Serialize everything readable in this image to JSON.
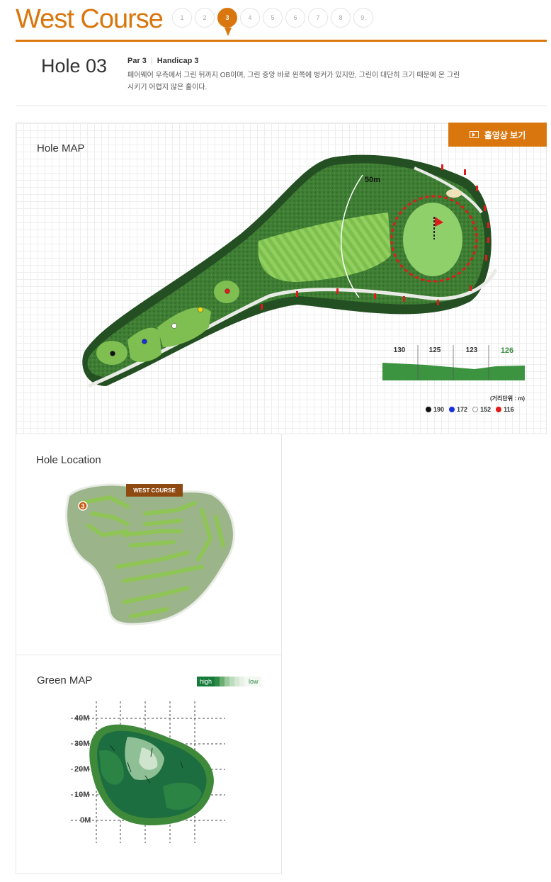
{
  "course": {
    "title": "West Course",
    "holes": [
      "1",
      "2",
      "3",
      "4",
      "5",
      "6",
      "7",
      "8",
      "9."
    ],
    "active_hole": "3"
  },
  "hole": {
    "name": "Hole 03",
    "par": "Par 3",
    "handicap": "Handicap 3",
    "description": "페어웨어 우측에서 그린 뒤까지 OB이며, 그린 중앙 바로 왼쪽에 벙커가 있지만, 그린이 대단히 크기 때문에 온 그린 시키기 어렵지 않은 홀이다."
  },
  "hole_map": {
    "title": "Hole MAP",
    "video_button": "홀영상 보기",
    "marker_label": "50m",
    "distances": [
      "130",
      "125",
      "123",
      "126"
    ],
    "unit_label": "(거리단위 : m)",
    "tees": [
      {
        "color": "#111111",
        "value": "190",
        "icon": "black-tee"
      },
      {
        "color": "#1730d6",
        "value": "172",
        "icon": "blue-tee"
      },
      {
        "color": "#ffffff",
        "value": "152",
        "icon": "white-tee"
      },
      {
        "color": "#e11b1b",
        "value": "116",
        "icon": "red-tee"
      }
    ]
  },
  "hole_location": {
    "title": "Hole Location",
    "badge": "WEST COURSE",
    "hole_marker": "3"
  },
  "green_map": {
    "title": "Green MAP",
    "legend_high": "high",
    "legend_low": "low",
    "slope_colors": [
      "#2f8a45",
      "#69ad72",
      "#9cc99f",
      "#bddbbd",
      "#d5e8d3",
      "#e7f1e5"
    ],
    "y_labels": [
      "40M",
      "30M",
      "20M",
      "10M",
      "0M"
    ]
  },
  "colors": {
    "accent": "#d9770e",
    "badge": "#8e4a10",
    "green_dark": "#1f6a33"
  }
}
